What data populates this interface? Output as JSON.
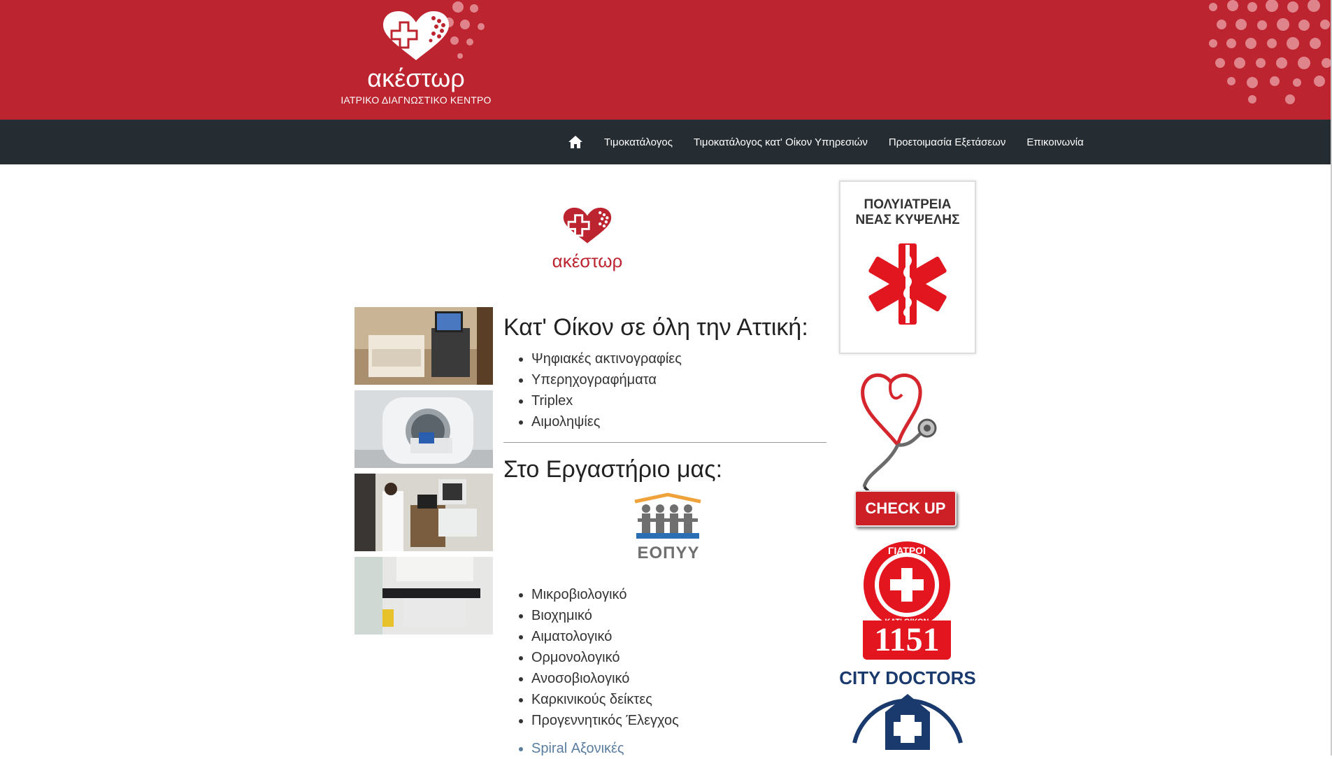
{
  "brand": {
    "name": "ακέστωρ",
    "subtitle": "ΙΑΤΡΙΚΟ ΔΙΑΓΝΩΣΤΙΚΟ ΚΕΝΤΡΟ"
  },
  "colors": {
    "header_red": "#bc2430",
    "nav_dark": "#252d33",
    "link_blue": "#5b7ea0"
  },
  "nav": {
    "home_icon": "home-icon",
    "items": [
      {
        "label": "Τιμοκατάλογος"
      },
      {
        "label": "Τιμοκατάλογος κατ' Οίκον Υπηρεσιών"
      },
      {
        "label": "Προετοιμασία Εξετάσεων"
      },
      {
        "label": "Επικοινωνία"
      }
    ]
  },
  "main": {
    "logo_text": "ακέστωρ",
    "home_title": "Κατ' Οίκον σε όλη την Αττική:",
    "home_services": [
      "Ψηφιακές ακτινογραφίες",
      "Υπερηχογραφήματα",
      "Triplex",
      "Αιμοληψίες"
    ],
    "lab_title": "Στο Εργαστήριο μας:",
    "eopyy_label": "ΕΟΠΥΥ",
    "lab_services": [
      "Μικροβιολογικό",
      "Βιοχημικό",
      "Αιματολογικό",
      "Ορμονολογικό",
      "Ανοσοβιολογικό",
      "Καρκινικούς δείκτες",
      "Προγεννητικός Έλεγχος"
    ],
    "more_services": [
      "Spiral Αξονικές"
    ]
  },
  "sidebar": {
    "ad1_title_line1": "ΠΟΛΥΙΑΤΡΕΙΑ",
    "ad1_title_line2": "ΝΕΑΣ ΚΥΨΕΛΗΣ",
    "checkup_label": "CHECK UP",
    "ad3_top": "ΓΙΑΤΡΟΙ",
    "ad3_bottom": "ΚΑΤ' ΟΙΚΟΝ",
    "ad3_number": "1151",
    "ad4_label": "CITY DOCTORS"
  }
}
